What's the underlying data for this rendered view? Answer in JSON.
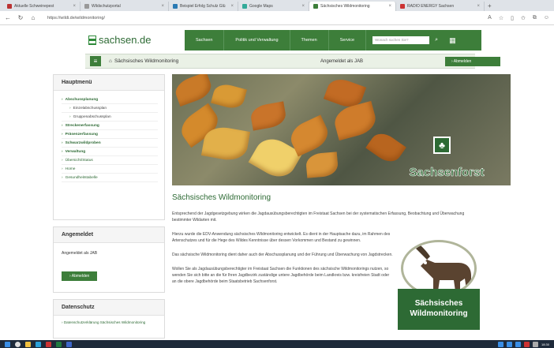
{
  "browser": {
    "tabs": [
      {
        "label": "Aktuelle Schweinepest",
        "color": "#b33"
      },
      {
        "label": "Wildschutzportal",
        "color": "#999"
      },
      {
        "label": "Beispiel Erfolg Schulz Glü",
        "color": "#2a7ab3"
      },
      {
        "label": "Google Maps",
        "color": "#3a9"
      },
      {
        "label": "Sächsisches Wildmonitoring",
        "color": "#3d7e3a"
      },
      {
        "label": "RADIO ENERGY Sachsen",
        "color": "#c33"
      }
    ],
    "url": "https://wildi.de/wildmonitoring/"
  },
  "site": {
    "logo_text": "sachsen.de",
    "nav": [
      "Sachsen",
      "Politik und Verwaltung",
      "Themen",
      "Service"
    ],
    "search_placeholder": "Wonach suchen Sie?"
  },
  "subbar": {
    "title": "Sächsisches Wildmonitoring",
    "logged_in": "Angemeldet als JAB",
    "logout": "Abmelden"
  },
  "sidebar": {
    "menu_title": "Hauptmenü",
    "menu_items": [
      {
        "label": "Abschussplanung",
        "sub": false,
        "bold": true
      },
      {
        "label": "Einzelabschussplan",
        "sub": true,
        "bold": false
      },
      {
        "label": "Gruppenabschussplan",
        "sub": true,
        "bold": false
      },
      {
        "label": "Streckenerfassung",
        "sub": false,
        "bold": true
      },
      {
        "label": "Präsenzerfassung",
        "sub": false,
        "bold": true
      },
      {
        "label": "Schwarzwildproben",
        "sub": false,
        "bold": true
      },
      {
        "label": "Verwaltung",
        "sub": false,
        "bold": true
      },
      {
        "label": "Übersicht/Status",
        "sub": false,
        "bold": false
      },
      {
        "label": "Home",
        "sub": false,
        "bold": false
      },
      {
        "label": "Gesundheitstabelle",
        "sub": false,
        "bold": false
      }
    ],
    "login_title": "Angemeldet",
    "login_text": "Angemeldet als JAB",
    "logout_btn": "Abmelden",
    "privacy_title": "Datenschutz",
    "privacy_link": "Datenschutzerklärung Sächsisches Wildmonitoring"
  },
  "hero": {
    "brand": "Sachsenforst"
  },
  "content": {
    "title": "Sächsisches Wildmonitoring",
    "paragraphs": [
      "Entsprechend der Jagdgesetzgebung wirken die Jagdausübungsberechtigten im Freistaat Sachsen bei der systematischen Erfassung, Beobachtung und Überwachung bestimmter Wildarten mit.",
      "Hierzu wurde die EDV-Anwendung sächsisches Wildmonitoring entwickelt. Es dient in der Hauptsache dazu, im Rahmen des Artenschutzes und für die Hege des Wildes Kenntnisse über dessen Vorkommen und Bestand zu gewinnen.",
      "Das sächsische Wildmonitoring dient daher auch der Abschussplanung und der Führung und Überwachung von Jagdstrecken.",
      "Wollen Sie als Jagdausübungsberechtigter im Freistaat Sachsen die Funktionen des sächsische Wildmonitorings nutzen, so wenden Sie sich bitte an die für Ihren Jagdbezirk zuständige untere Jagdbehörde beim Landkreis bzw. kreisfreien Stadt oder an die obere Jagdbehörde beim Staatsbetrieb Sachsenforst."
    ],
    "logo_line1": "Sächsisches",
    "logo_line2": "Wildmonitoring"
  },
  "taskbar": {
    "time": "18:30"
  }
}
